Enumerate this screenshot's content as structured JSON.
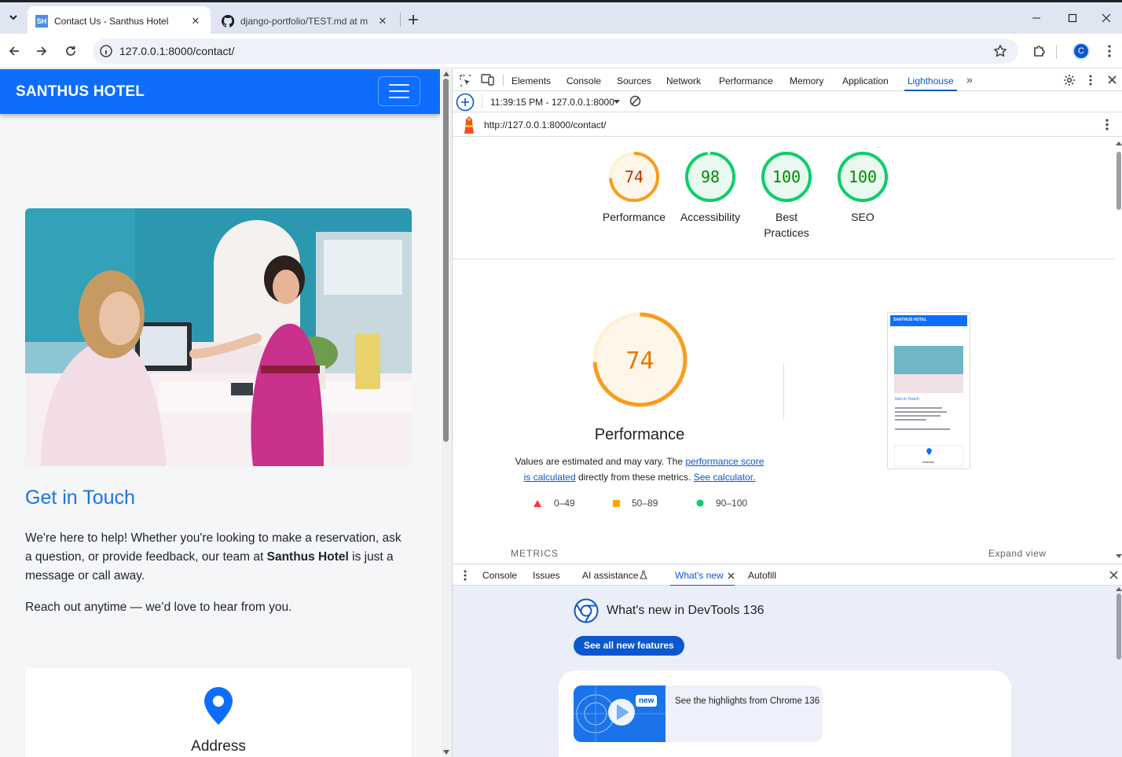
{
  "browser": {
    "tabs": [
      {
        "title": "Contact Us - Santhus Hotel",
        "favicon": "SH"
      },
      {
        "title": "django-portfolio/TEST.md at m"
      }
    ],
    "url": "127.0.0.1:8000/contact/",
    "profile_initial": "C"
  },
  "page": {
    "brand": "SANTHUS HOTEL",
    "heading": "Get in Touch",
    "intro_before": "We're here to help! Whether you're looking to make a reservation, ask a question, or provide feedback, our team at ",
    "intro_strong": "Santhus Hotel",
    "intro_after": " is just a message or call away.",
    "reach_out": "Reach out anytime — we’d love to hear from you.",
    "card_title": "Address"
  },
  "devtools": {
    "tabs": [
      "Elements",
      "Console",
      "Sources",
      "Network",
      "Performance",
      "Memory",
      "Application",
      "Lighthouse"
    ],
    "active_tab": "Lighthouse",
    "report_select": "11:39:15 PM - 127.0.0.1:8000",
    "report_url": "http://127.0.0.1:8000/contact/",
    "scores": [
      {
        "label": "Performance",
        "score": 74,
        "color": "#fa9c1e"
      },
      {
        "label": "Accessibility",
        "score": 98,
        "color": "#0cce6b"
      },
      {
        "label": "Best Practices",
        "score": 100,
        "color": "#0cce6b"
      },
      {
        "label": "SEO",
        "score": 100,
        "color": "#0cce6b"
      }
    ],
    "big_score": 74,
    "big_title": "Performance",
    "desc_prefix": "Values are estimated and may vary. The ",
    "desc_link1": "performance score is calculated",
    "desc_middle": " directly from these metrics. ",
    "desc_link2": "See calculator.",
    "legend": [
      {
        "range": "0–49",
        "color": "#ff3333"
      },
      {
        "range": "50–89",
        "color": "#ffa400"
      },
      {
        "range": "90–100",
        "color": "#0cce6b"
      }
    ],
    "metrics_label": "METRICS",
    "expand_label": "Expand view",
    "thumbnail": {
      "brand": "SANTHUS HOTEL",
      "heading": "Get in Touch",
      "address": "Address"
    }
  },
  "drawer": {
    "tabs": [
      "Console",
      "Issues",
      "AI assistance",
      "What's new",
      "Autofill"
    ],
    "active_tab": "What's new",
    "whats_new_title": "What's new in DevTools 136",
    "see_all": "See all new features",
    "badge": "new",
    "highlight": "See the highlights from Chrome 136"
  }
}
